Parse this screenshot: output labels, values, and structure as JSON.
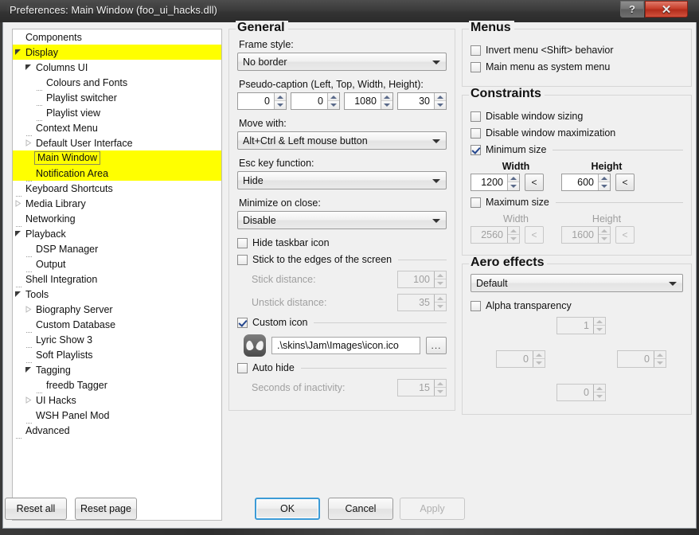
{
  "window": {
    "title": "Preferences: Main Window (foo_ui_hacks.dll)",
    "help_label": "?",
    "close_label": "✕"
  },
  "tree": {
    "items": [
      {
        "label": "Components",
        "depth": 0,
        "twisty": "none",
        "highlight": false,
        "selected": false
      },
      {
        "label": "Display",
        "depth": 0,
        "twisty": "open",
        "highlight": true,
        "selected": false
      },
      {
        "label": "Columns UI",
        "depth": 1,
        "twisty": "open",
        "highlight": false,
        "selected": false
      },
      {
        "label": "Colours and Fonts",
        "depth": 2,
        "twisty": "none",
        "highlight": false,
        "selected": false
      },
      {
        "label": "Playlist switcher",
        "depth": 2,
        "twisty": "none",
        "highlight": false,
        "selected": false
      },
      {
        "label": "Playlist view",
        "depth": 2,
        "twisty": "none",
        "highlight": false,
        "selected": false
      },
      {
        "label": "Context Menu",
        "depth": 1,
        "twisty": "none",
        "highlight": false,
        "selected": false
      },
      {
        "label": "Default User Interface",
        "depth": 1,
        "twisty": "closed",
        "highlight": false,
        "selected": false
      },
      {
        "label": "Main Window",
        "depth": 1,
        "twisty": "none",
        "highlight": true,
        "selected": true
      },
      {
        "label": "Notification Area",
        "depth": 1,
        "twisty": "none",
        "highlight": true,
        "selected": false
      },
      {
        "label": "Keyboard Shortcuts",
        "depth": 0,
        "twisty": "none",
        "highlight": false,
        "selected": false
      },
      {
        "label": "Media Library",
        "depth": 0,
        "twisty": "closed",
        "highlight": false,
        "selected": false
      },
      {
        "label": "Networking",
        "depth": 0,
        "twisty": "none",
        "highlight": false,
        "selected": false
      },
      {
        "label": "Playback",
        "depth": 0,
        "twisty": "open",
        "highlight": false,
        "selected": false
      },
      {
        "label": "DSP Manager",
        "depth": 1,
        "twisty": "none",
        "highlight": false,
        "selected": false
      },
      {
        "label": "Output",
        "depth": 1,
        "twisty": "none",
        "highlight": false,
        "selected": false
      },
      {
        "label": "Shell Integration",
        "depth": 0,
        "twisty": "none",
        "highlight": false,
        "selected": false
      },
      {
        "label": "Tools",
        "depth": 0,
        "twisty": "open",
        "highlight": false,
        "selected": false
      },
      {
        "label": "Biography Server",
        "depth": 1,
        "twisty": "closed",
        "highlight": false,
        "selected": false
      },
      {
        "label": "Custom Database",
        "depth": 1,
        "twisty": "none",
        "highlight": false,
        "selected": false
      },
      {
        "label": "Lyric Show 3",
        "depth": 1,
        "twisty": "none",
        "highlight": false,
        "selected": false
      },
      {
        "label": "Soft Playlists",
        "depth": 1,
        "twisty": "none",
        "highlight": false,
        "selected": false
      },
      {
        "label": "Tagging",
        "depth": 1,
        "twisty": "open",
        "highlight": false,
        "selected": false
      },
      {
        "label": "freedb Tagger",
        "depth": 2,
        "twisty": "none",
        "highlight": false,
        "selected": false
      },
      {
        "label": "UI Hacks",
        "depth": 1,
        "twisty": "closed",
        "highlight": false,
        "selected": false
      },
      {
        "label": "WSH Panel Mod",
        "depth": 1,
        "twisty": "none",
        "highlight": false,
        "selected": false
      },
      {
        "label": "Advanced",
        "depth": 0,
        "twisty": "none",
        "highlight": false,
        "selected": false
      }
    ]
  },
  "general": {
    "title": "General",
    "frame_style_label": "Frame style:",
    "frame_style_value": "No border",
    "pseudo_caption_label": "Pseudo-caption (Left, Top, Width, Height):",
    "pseudo_caption": [
      "0",
      "0",
      "1080",
      "30"
    ],
    "move_with_label": "Move with:",
    "move_with_value": "Alt+Ctrl & Left mouse button",
    "esc_key_label": "Esc key function:",
    "esc_key_value": "Hide",
    "minimize_on_close_label": "Minimize on close:",
    "minimize_on_close_value": "Disable",
    "hide_taskbar_icon_label": "Hide taskbar icon",
    "hide_taskbar_icon_checked": false,
    "stick_edges_label": "Stick to the edges of the screen",
    "stick_edges_checked": false,
    "stick_distance_label": "Stick distance:",
    "stick_distance_value": "100",
    "unstick_distance_label": "Unstick distance:",
    "unstick_distance_value": "35",
    "custom_icon_label": "Custom icon",
    "custom_icon_checked": true,
    "custom_icon_path": ".\\skins\\Jam\\Images\\icon.ico",
    "browse_label": "...",
    "auto_hide_label": "Auto hide",
    "auto_hide_checked": false,
    "seconds_inactivity_label": "Seconds of inactivity:",
    "seconds_inactivity_value": "15"
  },
  "menus": {
    "title": "Menus",
    "invert_shift_label": "Invert menu <Shift> behavior",
    "invert_shift_checked": false,
    "main_menu_system_label": "Main menu as system menu",
    "main_menu_system_checked": false
  },
  "constraints": {
    "title": "Constraints",
    "disable_sizing_label": "Disable window sizing",
    "disable_sizing_checked": false,
    "disable_max_label": "Disable window maximization",
    "disable_max_checked": false,
    "min_size_label": "Minimum size",
    "min_size_checked": true,
    "width_header": "Width",
    "height_header": "Height",
    "min_width": "1200",
    "min_height": "600",
    "max_size_label": "Maximum size",
    "max_size_checked": false,
    "max_width_header": "Width",
    "max_height_header": "Height",
    "max_width": "2560",
    "max_height": "1600",
    "pick_label": "<"
  },
  "aero": {
    "title": "Aero effects",
    "preset_value": "Default",
    "alpha_label": "Alpha transparency",
    "alpha_checked": false,
    "top_value": "1",
    "left_value": "0",
    "right_value": "0",
    "bottom_value": "0"
  },
  "buttons": {
    "reset_all": "Reset all",
    "reset_page": "Reset page",
    "ok": "OK",
    "cancel": "Cancel",
    "apply": "Apply"
  }
}
